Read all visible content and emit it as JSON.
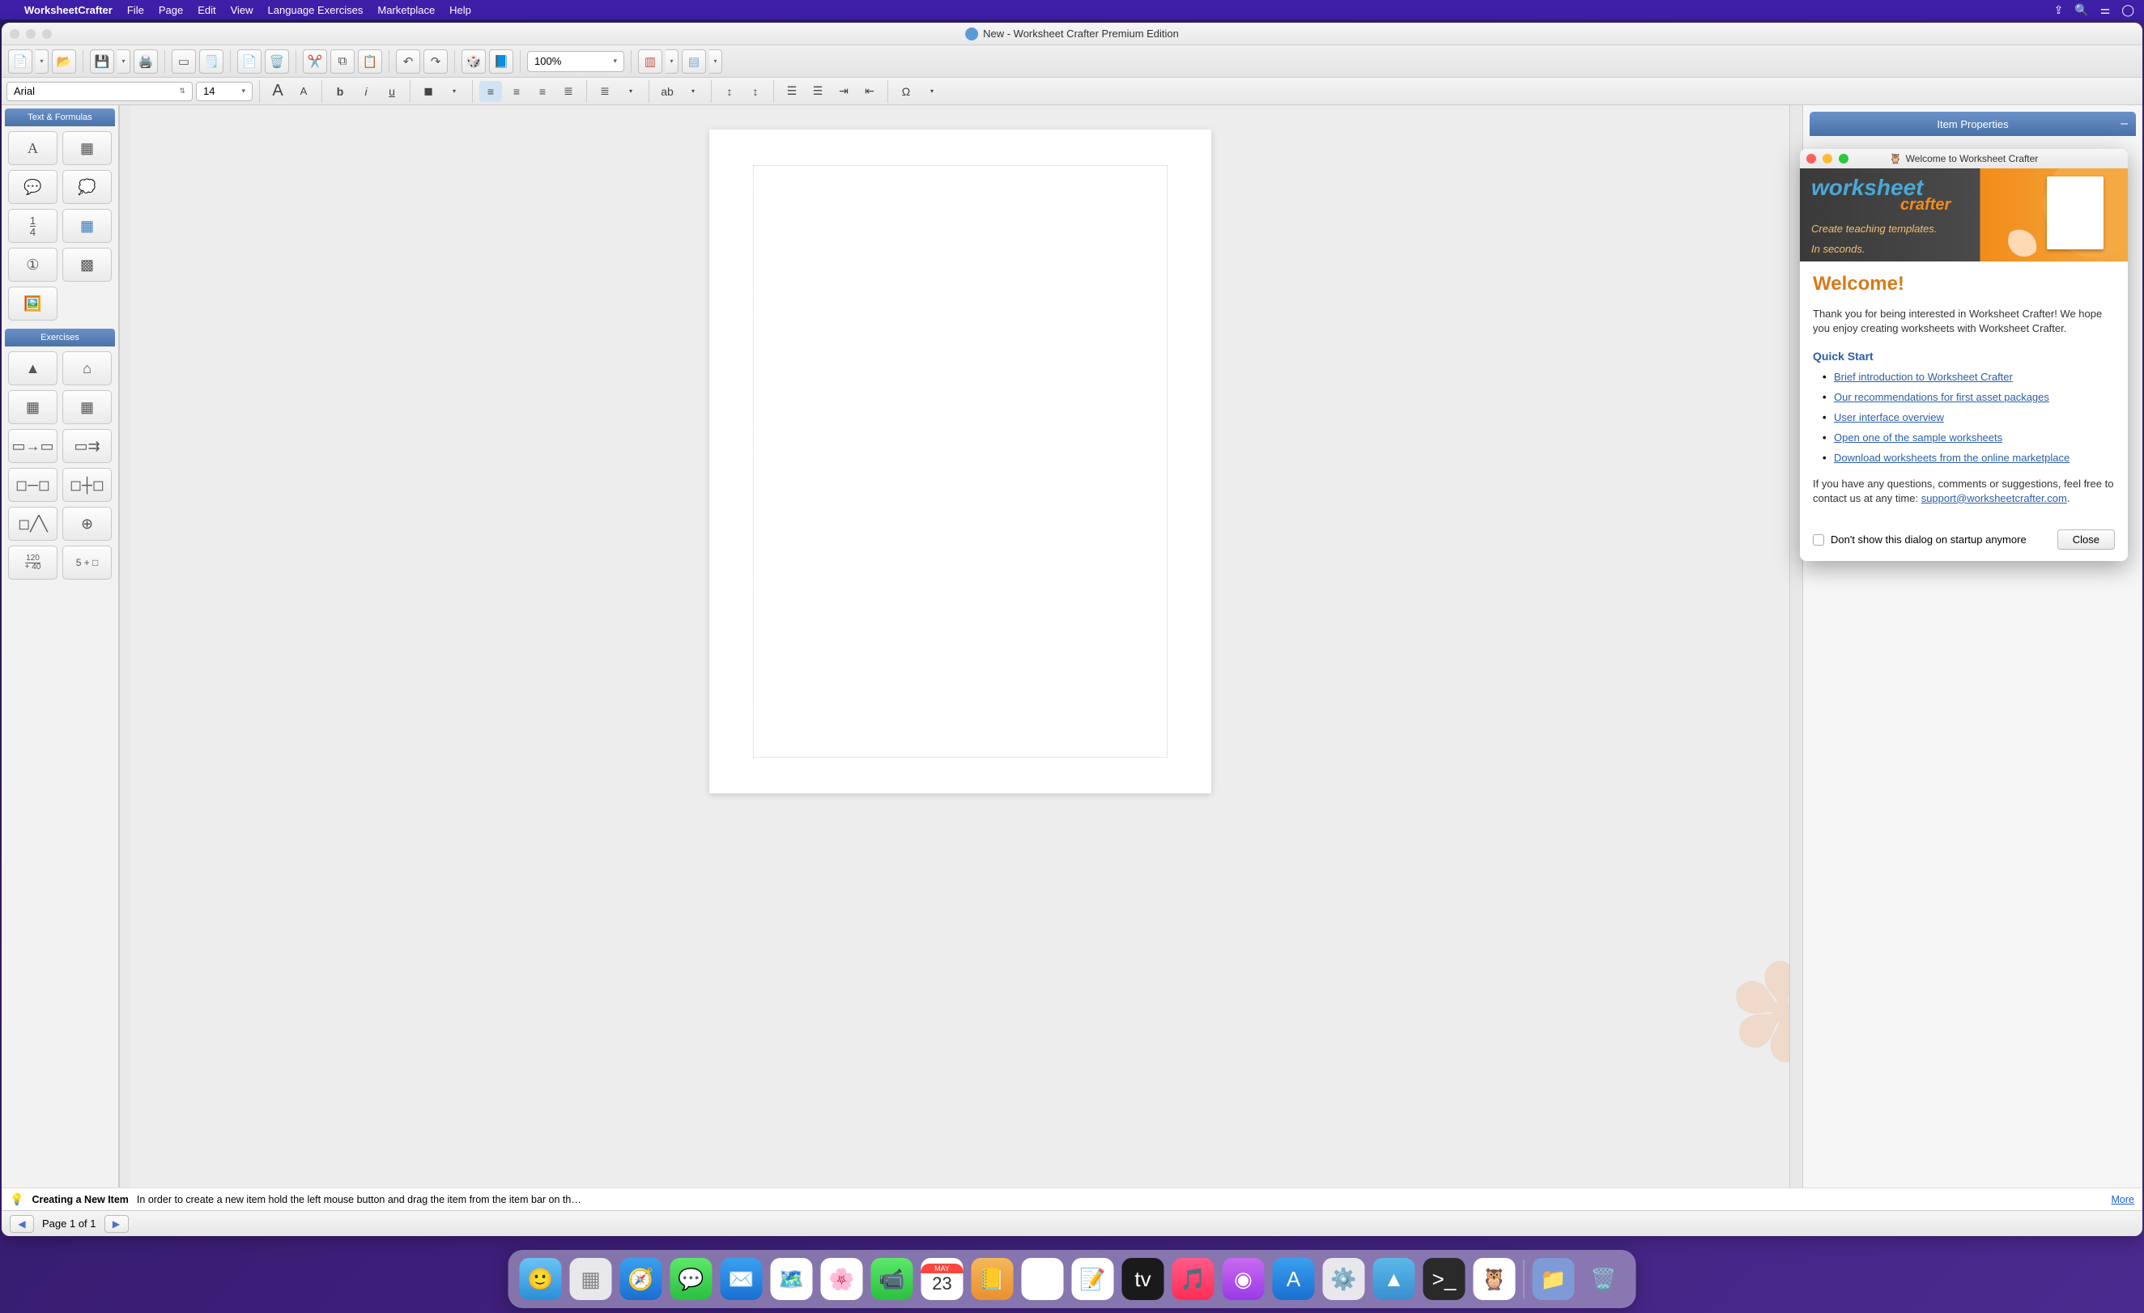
{
  "menubar": {
    "app_name": "WorksheetCrafter",
    "items": [
      "File",
      "Page",
      "Edit",
      "View",
      "Language Exercises",
      "Marketplace",
      "Help"
    ]
  },
  "window": {
    "title": "New  - Worksheet Crafter Premium Edition"
  },
  "toolbar1": {
    "zoom": "100%"
  },
  "toolbar2": {
    "font": "Arial",
    "size": "14"
  },
  "left_panel": {
    "section1": "Text & Formulas",
    "section2": "Exercises",
    "last_row_a": "120",
    "last_row_a2": "+ 40",
    "last_row_b": "5 + □"
  },
  "hint": {
    "title": "Creating a New Item",
    "body": "In order to create a new item hold the left mouse button and drag the item from the item bar on th…",
    "more": "More"
  },
  "page_nav": {
    "label": "Page 1 of 1"
  },
  "props": {
    "title": "Item Properties"
  },
  "welcome": {
    "dialog_title": "Welcome to Worksheet Crafter",
    "brand1": "worksheet",
    "brand2": "crafter",
    "tagline1": "Create teaching templates.",
    "tagline2": "In seconds.",
    "heading": "Welcome!",
    "intro": "Thank you for being interested in Worksheet Crafter! We hope you enjoy creating worksheets with Worksheet Crafter.",
    "quick_start": "Quick Start",
    "links": [
      "Brief introduction to Worksheet Crafter",
      "Our recommendations for first asset packages",
      "User interface overview",
      "Open one of the sample worksheets",
      "Download worksheets from the online marketplace"
    ],
    "contact_pre": "If you have any questions, comments or suggestions, feel free to contact us at any time: ",
    "contact_email": "support@worksheetcrafter.com",
    "dont_show": "Don't show this dialog on startup anymore",
    "close": "Close"
  },
  "dock": {
    "calendar_month": "MAY",
    "calendar_day": "23"
  }
}
